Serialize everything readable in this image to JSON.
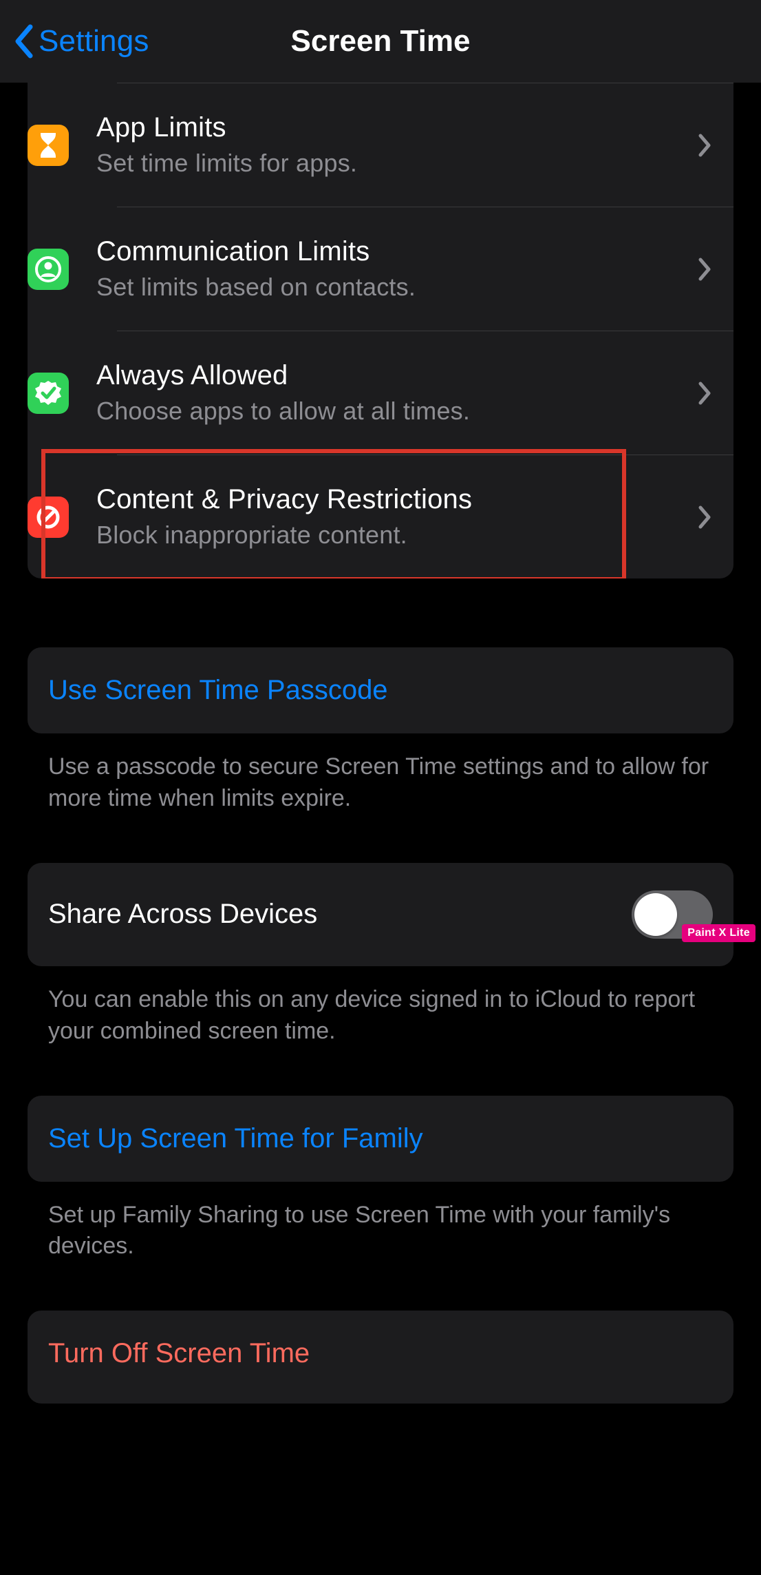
{
  "nav": {
    "back_label": "Settings",
    "title": "Screen Time"
  },
  "items": [
    {
      "title": "App Limits",
      "subtitle": "Set time limits for apps.",
      "icon": "hourglass",
      "color": "orange"
    },
    {
      "title": "Communication Limits",
      "subtitle": "Set limits based on contacts.",
      "icon": "person-circle",
      "color": "green"
    },
    {
      "title": "Always Allowed",
      "subtitle": "Choose apps to allow at all times.",
      "icon": "checkmark-seal",
      "color": "green"
    },
    {
      "title": "Content & Privacy Restrictions",
      "subtitle": "Block inappropriate content.",
      "icon": "no-sign",
      "color": "red",
      "highlighted": true
    }
  ],
  "passcode": {
    "label": "Use Screen Time Passcode",
    "footer": "Use a passcode to secure Screen Time settings and to allow for more time when limits expire."
  },
  "share": {
    "label": "Share Across Devices",
    "on": false,
    "footer": "You can enable this on any device signed in to iCloud to report your combined screen time."
  },
  "family": {
    "label": "Set Up Screen Time for Family",
    "footer": "Set up Family Sharing to use Screen Time with your family's devices."
  },
  "turn_off": {
    "label": "Turn Off Screen Time"
  },
  "watermark": "Paint X Lite"
}
